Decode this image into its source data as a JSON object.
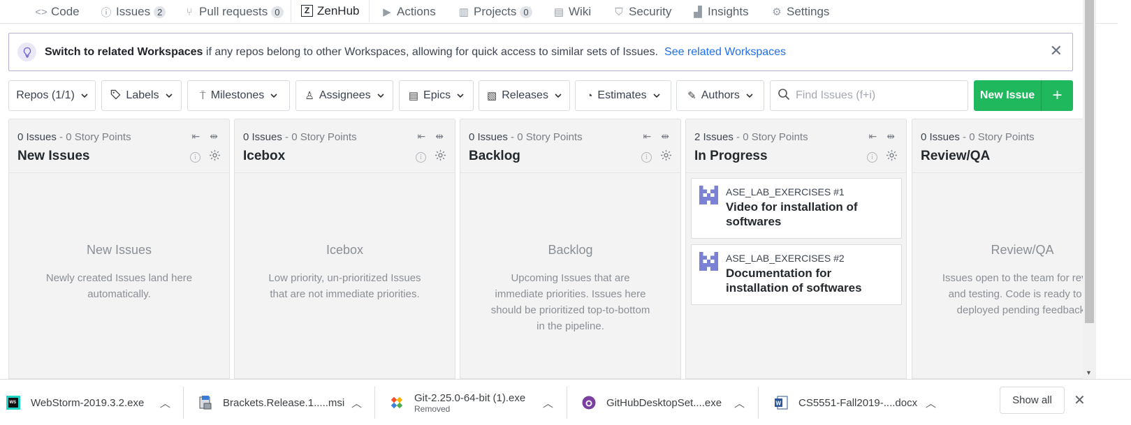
{
  "nav": {
    "tabs": [
      {
        "label": "Code",
        "icon": "code-icon"
      },
      {
        "label": "Issues",
        "count": "2",
        "icon": "issue-icon"
      },
      {
        "label": "Pull requests",
        "count": "0",
        "icon": "pull-request-icon"
      },
      {
        "label": "ZenHub",
        "icon": "zenhub-icon",
        "selected": true
      },
      {
        "label": "Actions",
        "icon": "play-icon"
      },
      {
        "label": "Projects",
        "count": "0",
        "icon": "project-icon"
      },
      {
        "label": "Wiki",
        "icon": "book-icon"
      },
      {
        "label": "Security",
        "icon": "shield-icon"
      },
      {
        "label": "Insights",
        "icon": "graph-icon"
      },
      {
        "label": "Settings",
        "icon": "gear-icon"
      }
    ]
  },
  "banner": {
    "bold": "Switch to related Workspaces",
    "text": " if any repos belong to other Workspaces, allowing for quick access to similar sets of Issues.",
    "link": "See related Workspaces",
    "close": "✕"
  },
  "toolbar": {
    "filters": [
      {
        "label": "Repos (1/1)"
      },
      {
        "label": "Labels",
        "icon": "tag-icon"
      },
      {
        "label": "Milestones",
        "icon": "milestone-icon"
      },
      {
        "label": "Assignees",
        "icon": "person-icon"
      },
      {
        "label": "Epics",
        "icon": "epic-icon"
      },
      {
        "label": "Releases",
        "icon": "release-icon"
      },
      {
        "label": "Estimates",
        "icon": "estimate-icon"
      },
      {
        "label": "Authors",
        "icon": "pencil-icon"
      }
    ],
    "search_placeholder": "Find Issues (f+i)",
    "new_issue": "New Issue",
    "plus": "+"
  },
  "pipelines": [
    {
      "count": "0 Issues",
      "points": " - 0 Story Points",
      "title": "New Issues",
      "empty_title": "New Issues",
      "empty_desc": "Newly created Issues land here automatically."
    },
    {
      "count": "0 Issues",
      "points": " - 0 Story Points",
      "title": "Icebox",
      "empty_title": "Icebox",
      "empty_desc": "Low priority, un-prioritized Issues that are not immediate priorities."
    },
    {
      "count": "0 Issues",
      "points": " - 0 Story Points",
      "title": "Backlog",
      "empty_title": "Backlog",
      "empty_desc": "Upcoming Issues that are immediate priorities. Issues here should be prioritized top-to-bottom in the pipeline."
    },
    {
      "count": "2 Issues",
      "points": " - 0 Story Points",
      "title": "In Progress",
      "issues": [
        {
          "repo": "ASE_LAB_EXERCISES #1",
          "title": "Video for installation of softwares"
        },
        {
          "repo": "ASE_LAB_EXERCISES #2",
          "title": "Documentation for installation of softwares"
        }
      ]
    },
    {
      "count": "0 Issues",
      "points": " - 0 Story Points",
      "title": "Review/QA",
      "empty_title": "Review/QA",
      "empty_desc": "Issues open to the team for review and testing. Code is ready to be deployed pending feedback."
    }
  ],
  "downloads": {
    "items": [
      {
        "name": "WebStorm-2019.3.2.exe",
        "icon": "webstorm-icon"
      },
      {
        "name": "Brackets.Release.1.....msi",
        "icon": "installer-icon"
      },
      {
        "name": "Git-2.25.0-64-bit (1).exe",
        "sub": "Removed",
        "icon": "git-icon"
      },
      {
        "name": "GitHubDesktopSet....exe",
        "icon": "github-desktop-icon"
      },
      {
        "name": "CS5551-Fall2019-....docx",
        "icon": "word-icon"
      }
    ],
    "show_all": "Show all",
    "close": "✕"
  }
}
